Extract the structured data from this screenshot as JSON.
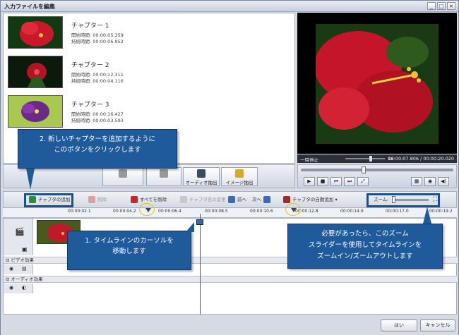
{
  "window": {
    "title": "入力ファイルを編集",
    "controls": [
      "_",
      "□",
      "×"
    ]
  },
  "chapters": [
    {
      "title": "チャプター 1",
      "start": "開始時間: 00:00:05.359",
      "duration": "持続時間: 00:00:06.952"
    },
    {
      "title": "チャプター 2",
      "start": "開始時間: 00:00:12.311",
      "duration": "持続時間: 00:00:04.116"
    },
    {
      "title": "チャプター 3",
      "start": "開始時間: 00:00:16.427",
      "duration": "持続時間: 00:00:03.593"
    }
  ],
  "player": {
    "status": "一時停止",
    "speed": "1x",
    "time": "00:00:07.806 / 00:00:20.020"
  },
  "mid_toolbar": {
    "audio_export": "オーディオ抽出",
    "image_export": "イメージ抽出"
  },
  "timeline_toolbar": {
    "add_chapter": "チャプタの追加",
    "delete": "削除",
    "delete_all": "すべてを削除",
    "rename": "チャプタ名の変更",
    "prev": "前へ",
    "next": "次へ",
    "auto_add": "チャプタの自動追加",
    "zoom": "ズーム:"
  },
  "ruler": [
    "00:00:02.1",
    "00:00:04.2",
    "00:00:06.4",
    "00:00:08.5",
    "00:00:10.6",
    "00:00:12.8",
    "00:00:14.9",
    "00:00:17.0",
    "00:00:19.2"
  ],
  "sections": {
    "video_effects": "ビデオ効果",
    "audio_effects": "オーディオ効果"
  },
  "buttons": {
    "ok": "はい",
    "cancel": "キャンセル"
  },
  "callouts": {
    "add_chapter": {
      "line1": "2. 新しいチャプターを追加するように",
      "line2": "このボタンをクリックします"
    },
    "cursor": {
      "line1": "1. タイムラインのカーソルを",
      "line2": "移動します"
    },
    "zoom": {
      "line1": "必要があったら、このズーム",
      "line2": "スライダーを使用してタイムラインを",
      "line3": "ズームイン/ズームアウトします"
    }
  },
  "colors": {
    "callout": "#1f5a9a",
    "highlight": "#1c4f8e",
    "circle": "#e3c22a"
  }
}
